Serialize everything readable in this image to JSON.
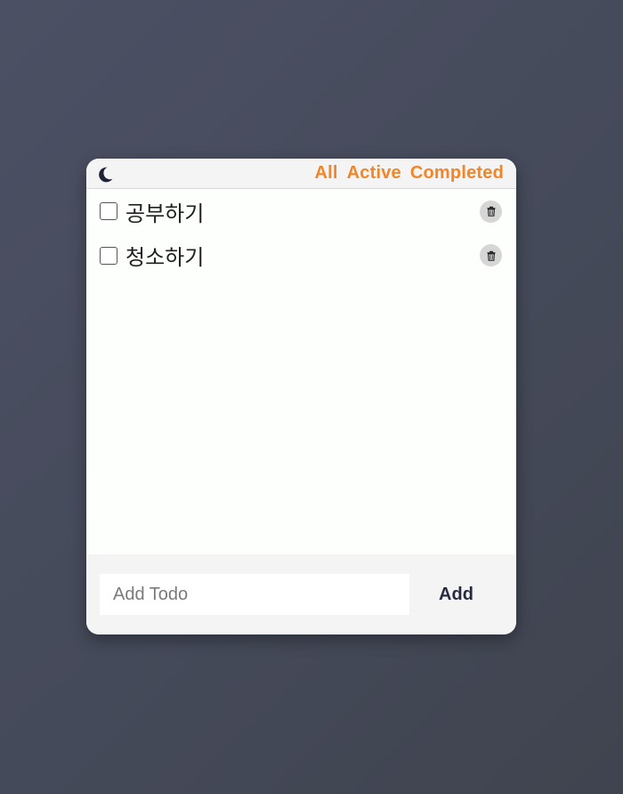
{
  "header": {
    "theme_icon": "moon-icon",
    "filters": [
      "All",
      "Active",
      "Completed"
    ],
    "filter_color": "#f0862a"
  },
  "todos": [
    {
      "text": "공부하기",
      "completed": false,
      "delete_icon": "trash-icon"
    },
    {
      "text": "청소하기",
      "completed": false,
      "delete_icon": "trash-icon"
    }
  ],
  "footer": {
    "input_placeholder": "Add Todo",
    "input_value": "",
    "add_label": "Add"
  },
  "colors": {
    "accent": "#f0862a",
    "button_text": "#262b3f",
    "card_bg": "#fdfffd",
    "panel_bg": "#f4f4f5"
  }
}
